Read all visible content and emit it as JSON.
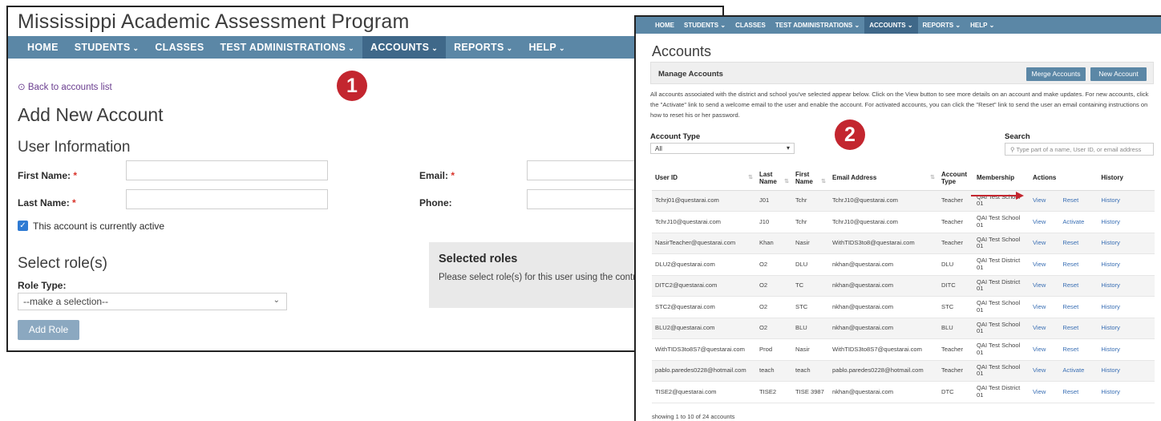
{
  "left_panel": {
    "app_title": "Mississippi Academic Assessment Program",
    "nav": [
      "HOME",
      "STUDENTS",
      "CLASSES",
      "TEST ADMINISTRATIONS",
      "ACCOUNTS",
      "REPORTS",
      "HELP"
    ],
    "back_link": "Back to accounts list",
    "heading": "Add New Account",
    "section_user_info": "User Information",
    "first_name_label": "First Name:",
    "last_name_label": "Last Name:",
    "email_label": "Email:",
    "phone_label": "Phone:",
    "required_mark": "*",
    "active_checkbox_label": "This account is currently active",
    "select_roles_heading": "Select role(s)",
    "role_type_label": "Role Type:",
    "role_select_value": "--make a selection--",
    "add_role_button": "Add Role",
    "selected_roles_title": "Selected roles",
    "selected_roles_text": "Please select role(s) for this user using the controls",
    "badge": "1"
  },
  "right_panel": {
    "nav": [
      "HOME",
      "STUDENTS",
      "CLASSES",
      "TEST ADMINISTRATIONS",
      "ACCOUNTS",
      "REPORTS",
      "HELP"
    ],
    "page_title": "Accounts",
    "manage_title": "Manage Accounts",
    "merge_button": "Merge Accounts",
    "new_button": "New Account",
    "intro_text": "All accounts associated with the district and school you've selected appear below. Click on the View button to see more details on an account and make updates. For new accounts, click the \"Activate\" link to send a welcome email to the user and enable the account. For activated accounts, you can click the \"Reset\" link to send the user an email containing instructions on how to reset his or her password.",
    "account_type_label": "Account Type",
    "account_type_value": "All",
    "search_label": "Search",
    "search_placeholder": "Type part of a name, User ID, or email address",
    "badge": "2",
    "columns": [
      "User ID",
      "Last Name",
      "First Name",
      "Email Address",
      "Account Type",
      "Membership",
      "Actions",
      "",
      "History"
    ],
    "rows": [
      [
        "Tchrj01@questarai.com",
        "J01",
        "Tchr",
        "TchrJ10@questarai.com",
        "Teacher",
        "QAI Test School 01",
        "View",
        "Reset",
        "History"
      ],
      [
        "TchrJ10@questarai.com",
        "J10",
        "Tchr",
        "TchrJ10@questarai.com",
        "Teacher",
        "QAI Test School 01",
        "View",
        "Activate",
        "History"
      ],
      [
        "NasirTeacher@questarai.com",
        "Khan",
        "Nasir",
        "WithTIDS3to8@questarai.com",
        "Teacher",
        "QAI Test School 01",
        "View",
        "Reset",
        "History"
      ],
      [
        "DLU2@questarai.com",
        "O2",
        "DLU",
        "nkhan@questarai.com",
        "DLU",
        "QAI Test District 01",
        "View",
        "Reset",
        "History"
      ],
      [
        "DITC2@questarai.com",
        "O2",
        "TC",
        "nkhan@questarai.com",
        "DITC",
        "QAI Test District 01",
        "View",
        "Reset",
        "History"
      ],
      [
        "STC2@questarai.com",
        "O2",
        "STC",
        "nkhan@questarai.com",
        "STC",
        "QAI Test School 01",
        "View",
        "Reset",
        "History"
      ],
      [
        "BLU2@questarai.com",
        "O2",
        "BLU",
        "nkhan@questarai.com",
        "BLU",
        "QAI Test School 01",
        "View",
        "Reset",
        "History"
      ],
      [
        "WithTIDS3to8S7@questarai.com",
        "Prod",
        "Nasir",
        "WithTIDS3to8S7@questarai.com",
        "Teacher",
        "QAI Test School 01",
        "View",
        "Reset",
        "History"
      ],
      [
        "pablo.paredes0228@hotmail.com",
        "teach",
        "teach",
        "pablo.paredes0228@hotmail.com",
        "Teacher",
        "QAI Test School 01",
        "View",
        "Activate",
        "History"
      ],
      [
        "TISE2@questarai.com",
        "TISE2",
        "TISE 3987",
        "nkhan@questarai.com",
        "DTC",
        "QAI Test District 01",
        "View",
        "Reset",
        "History"
      ]
    ],
    "showing_text": "showing 1 to 10 of 24 accounts"
  }
}
